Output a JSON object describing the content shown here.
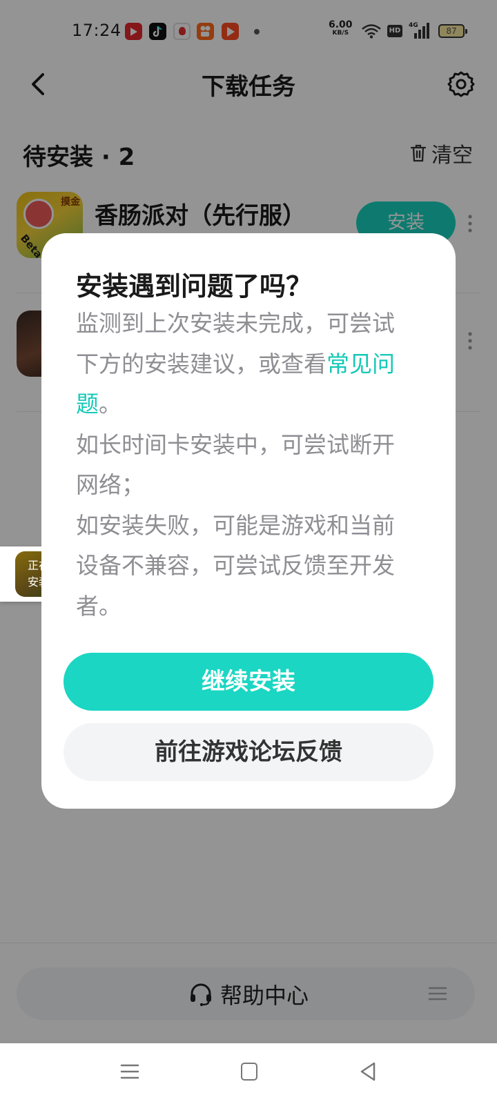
{
  "status_bar": {
    "time": "17:24",
    "net_speed_value": "6.00",
    "net_speed_unit": "KB/S",
    "hd_label": "HD",
    "signal_label": "4G",
    "battery_level": "87"
  },
  "header": {
    "title": "下载任务"
  },
  "section": {
    "title": "待安装 · 2",
    "clear_label": "清空"
  },
  "tasks": [
    {
      "name": "香肠派对（先行服）",
      "icon_tag": "摸金",
      "icon_badge": "Beta",
      "action_label": "安装"
    },
    {
      "name": ""
    }
  ],
  "floating_badge": {
    "line1": "正在",
    "line2": "安装"
  },
  "dialog": {
    "title": "安装遇到问题了吗？",
    "body_part1": "监测到上次安装未完成，可尝试下方的安装建议，或查看",
    "body_link": "常见问题",
    "body_part2": "。",
    "line2": "如长时间卡安装中，可尝试断开网络；",
    "line3": "如安装失败，可能是游戏和当前设备不兼容，可尝试反馈至开发者。",
    "primary_button": "继续安装",
    "secondary_button": "前往游戏论坛反馈"
  },
  "bottom": {
    "help_label": "帮助中心"
  },
  "colors": {
    "accent": "#1ad6c3",
    "link": "#14c9b8",
    "overlay": "rgba(0,0,0,0.42)"
  }
}
